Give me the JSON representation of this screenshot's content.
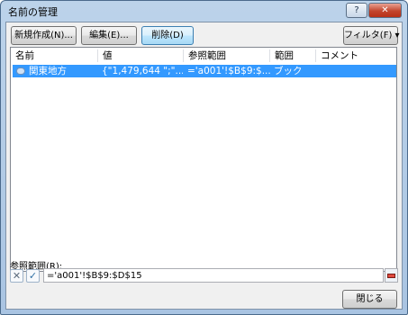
{
  "window": {
    "title": "名前の管理",
    "help_glyph": "?",
    "close_glyph": "✕"
  },
  "toolbar": {
    "new_label": "新規作成(N)...",
    "edit_label": "編集(E)...",
    "delete_label": "削除(D)",
    "filter_label": "フィルタ(F) ▾"
  },
  "list": {
    "columns": [
      "名前",
      "値",
      "参照範囲",
      "範囲",
      "コメント"
    ],
    "rows": [
      {
        "name": "関東地方",
        "value": "{\"1,479,644 \";\"...",
        "refers_to": "='a001'!$B$9:$...",
        "scope": "ブック",
        "comment": ""
      }
    ]
  },
  "refers_to": {
    "label": "参照範囲(R):",
    "value": "='a001'!$B$9:$D$15",
    "cancel_glyph": "✕",
    "confirm_glyph": "✓"
  },
  "footer": {
    "close_label": "閉じる"
  },
  "colors": {
    "selection": "#3399ff",
    "frame": "#bcd3ea"
  }
}
